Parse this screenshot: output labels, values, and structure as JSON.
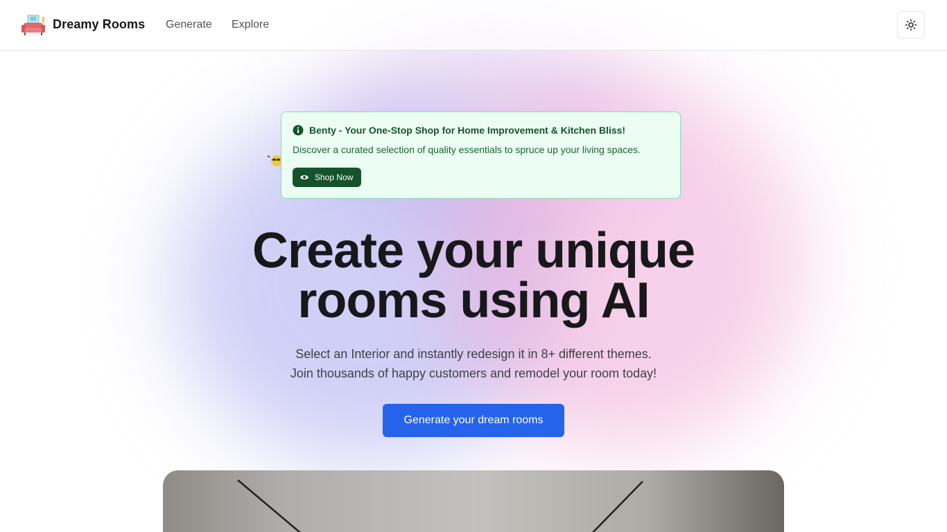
{
  "header": {
    "brand": "Dreamy Rooms",
    "logo_icon": "sofa-logo-icon",
    "nav": [
      {
        "label": "Generate"
      },
      {
        "label": "Explore"
      }
    ],
    "theme_toggle_icon": "sun-icon"
  },
  "promo": {
    "icon": "info-icon",
    "title": "Benty - Your One-Stop Shop for Home Improvement & Kitchen Bliss!",
    "description": "Discover a curated selection of quality essentials to spruce up your living spaces.",
    "button_label": "Shop Now",
    "button_icon": "eye-icon",
    "accent": "#14532d",
    "background": "#ecfdf3"
  },
  "hero": {
    "title_line1": "Create your unique",
    "title_line2": "rooms using AI",
    "subtitle_line1": "Select an Interior and instantly redesign it in 8+ different themes.",
    "subtitle_line2": "Join thousands of happy customers and remodel your room today!",
    "cta_label": "Generate your dream rooms",
    "cta_color": "#2563eb"
  },
  "preview": {
    "image": "room-interior-preview"
  }
}
